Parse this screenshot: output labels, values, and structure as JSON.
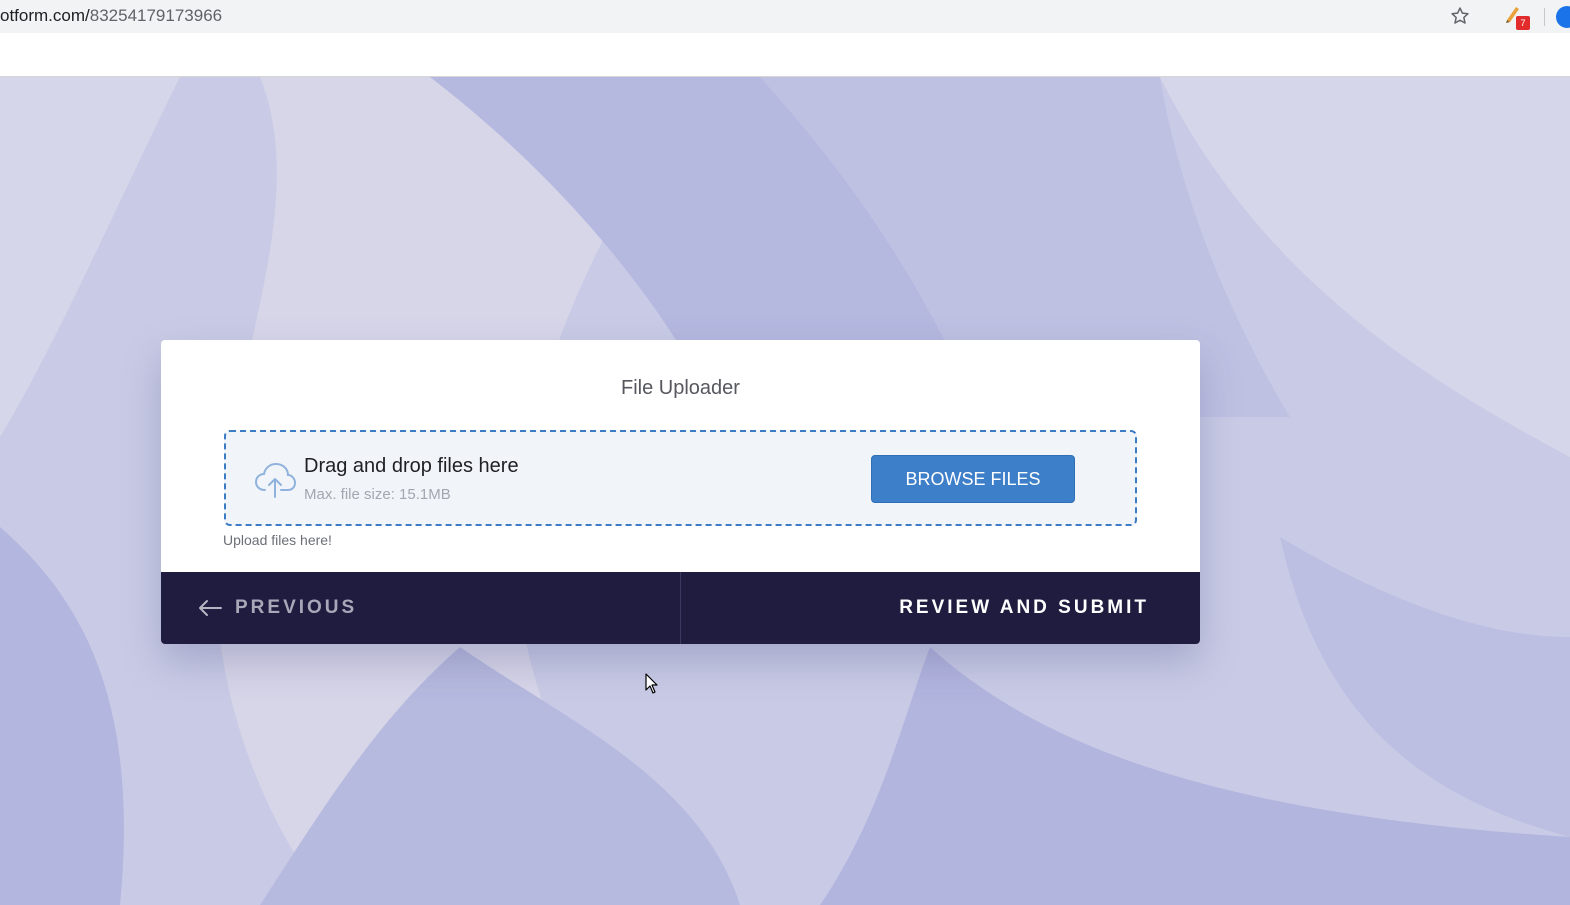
{
  "browser": {
    "url_host": "otform.com/",
    "url_path": "83254179173966",
    "extension_badge": "7"
  },
  "form": {
    "title": "File Uploader",
    "upload": {
      "drop_title": "Drag and drop files here",
      "max_size": "Max. file size: 15.1MB",
      "browse_label": "BROWSE FILES"
    },
    "helper_text": "Upload files here!",
    "nav": {
      "previous_label": "PREVIOUS",
      "submit_label": "REVIEW AND SUBMIT"
    }
  },
  "colors": {
    "background": "#c9cbe6",
    "card": "#ffffff",
    "accent": "#3d7fc8",
    "nav_bar": "#1f1c40"
  },
  "icons": {
    "star": "star-icon",
    "extension": "extension-icon",
    "profile": "profile-icon",
    "upload": "cloud-upload-icon",
    "previous": "arrow-left-icon",
    "cursor": "mouse-cursor-icon"
  }
}
